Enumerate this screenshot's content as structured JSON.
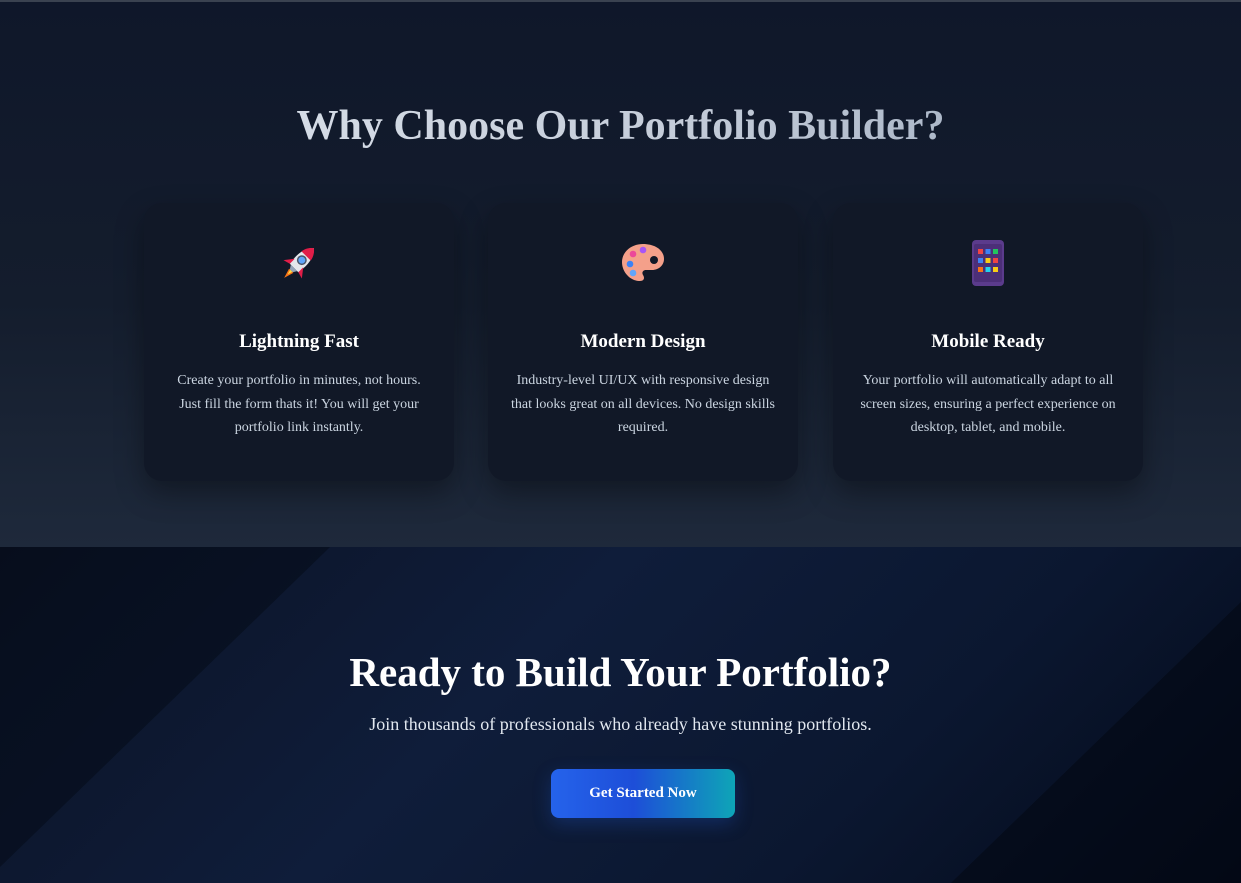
{
  "features": {
    "title": "Why Choose Our Portfolio Builder?",
    "cards": [
      {
        "icon": "rocket-icon",
        "title": "Lightning Fast",
        "description": "Create your portfolio in minutes, not hours. Just fill the form thats it! You will get your portfolio link instantly."
      },
      {
        "icon": "palette-icon",
        "title": "Modern Design",
        "description": "Industry-level UI/UX with responsive design that looks great on all devices. No design skills required."
      },
      {
        "icon": "mobile-icon",
        "title": "Mobile Ready",
        "description": "Your portfolio will automatically adapt to all screen sizes, ensuring a perfect experience on desktop, tablet, and mobile."
      }
    ]
  },
  "cta": {
    "title": "Ready to Build Your Portfolio?",
    "subtitle": "Join thousands of professionals who already have stunning portfolios.",
    "button_label": "Get Started Now"
  },
  "colors": {
    "background": "#0f172a",
    "card": "#111827",
    "button_start": "#2563eb",
    "button_end": "#0ea5b7"
  }
}
